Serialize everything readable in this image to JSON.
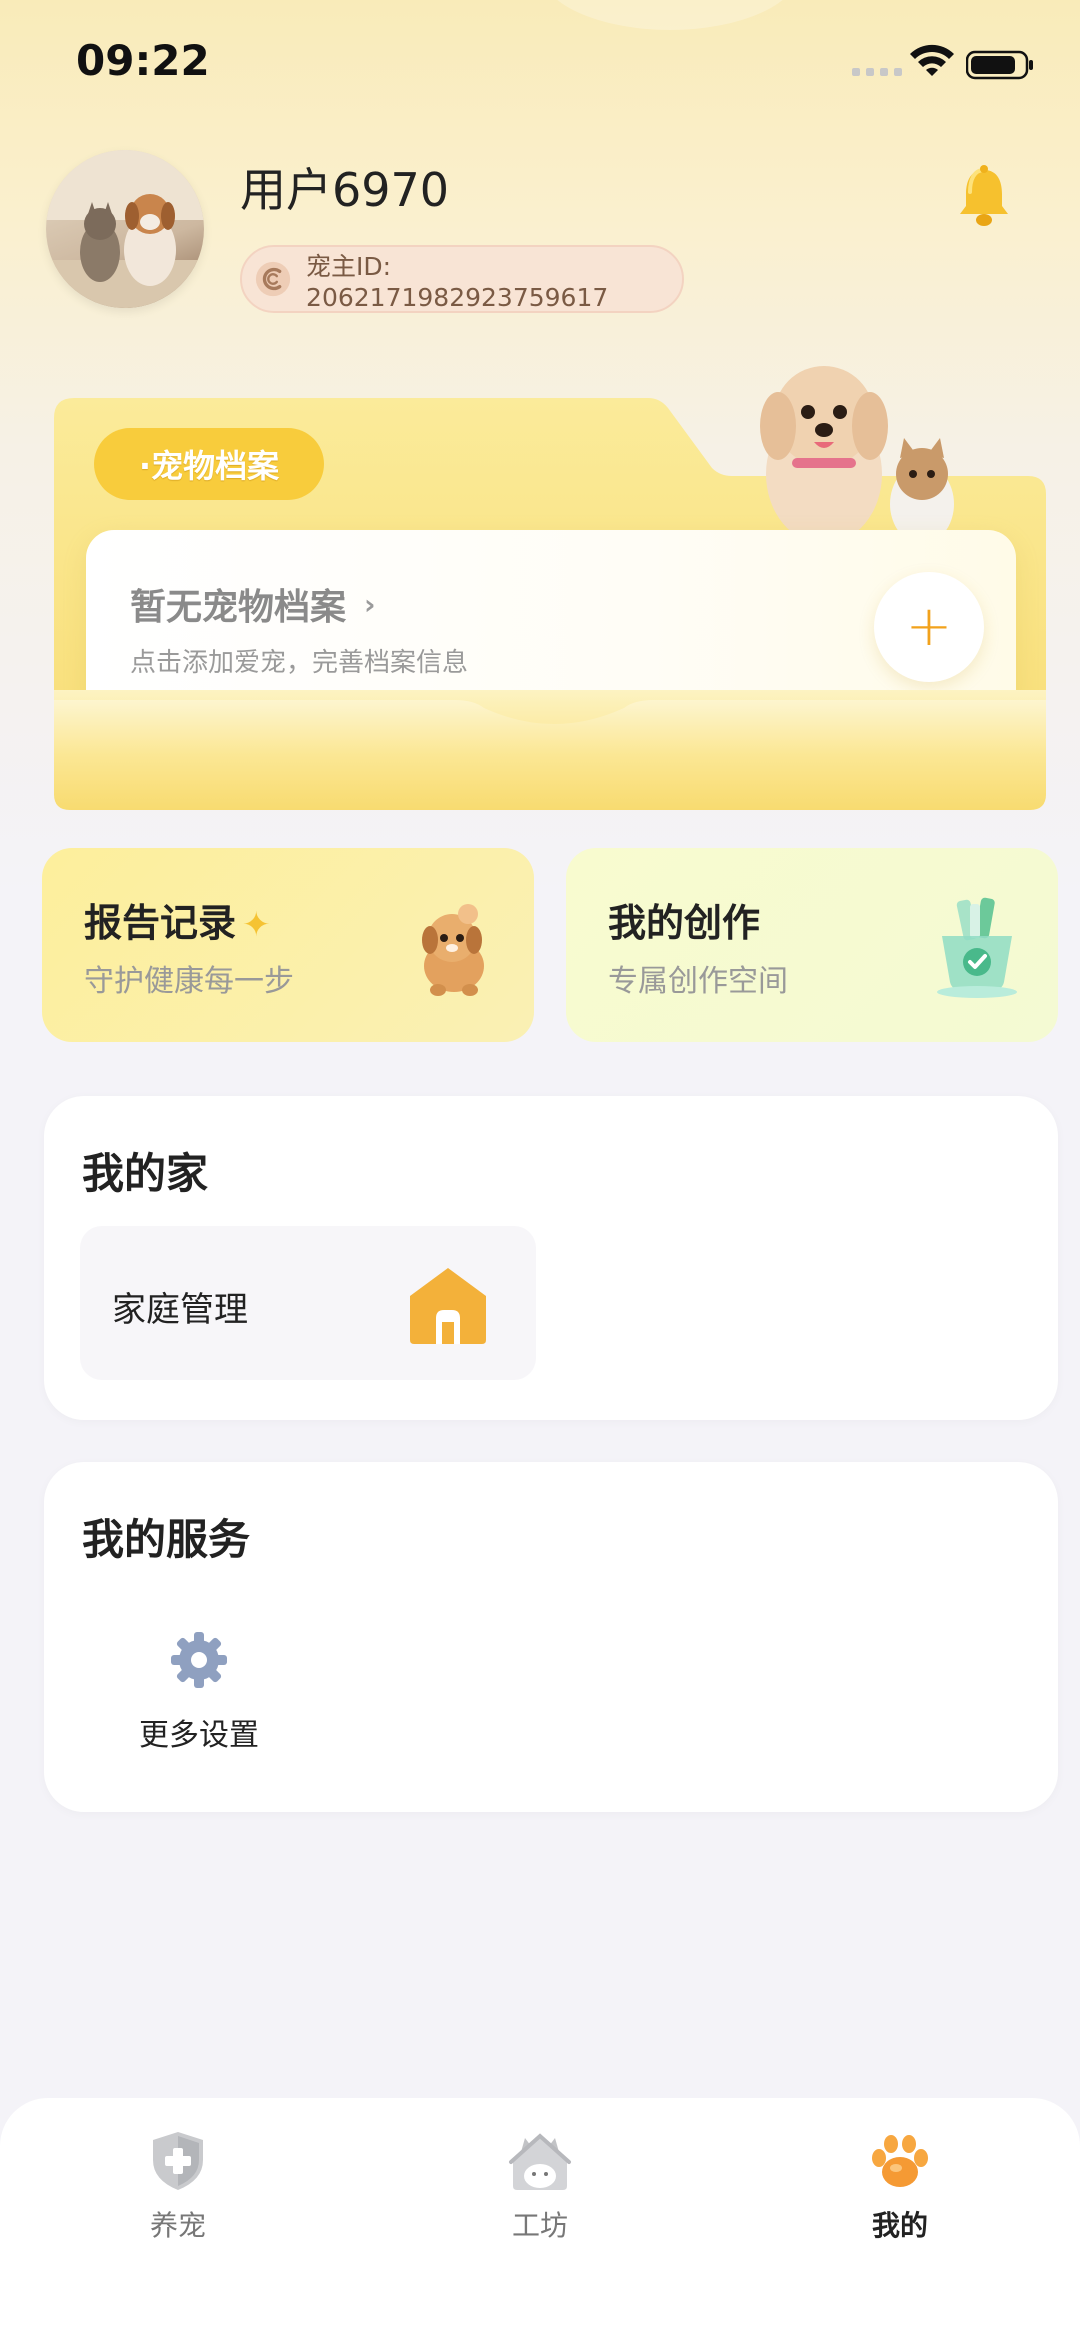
{
  "status_bar": {
    "time": "09:22"
  },
  "profile": {
    "username": "用户6970",
    "owner_id": "宠主ID: 2062171982923759617"
  },
  "pet_archive": {
    "tag": "·宠物档案",
    "empty_title": "暂无宠物档案",
    "empty_subtitle": "点击添加爱宠，完善档案信息",
    "add_symbol": "+"
  },
  "quick_cards": [
    {
      "title": "报告记录",
      "subtitle": "守护健康每一步",
      "icon": "dog-report-icon"
    },
    {
      "title": "我的创作",
      "subtitle": "专属创作空间",
      "icon": "creation-cup-icon"
    }
  ],
  "my_home": {
    "title": "我的家",
    "items": [
      {
        "label": "家庭管理",
        "icon": "house-icon"
      }
    ]
  },
  "my_services": {
    "title": "我的服务",
    "items": [
      {
        "label": "更多设置",
        "icon": "gear-icon"
      }
    ]
  },
  "bottom_nav": {
    "tabs": [
      {
        "label": "养宠",
        "icon": "shield-cross-icon"
      },
      {
        "label": "工坊",
        "icon": "cat-house-icon"
      },
      {
        "label": "我的",
        "icon": "paw-icon",
        "active": true
      }
    ]
  },
  "colors": {
    "accent": "#f2a21c",
    "brand_yellow": "#f8cc3c"
  }
}
